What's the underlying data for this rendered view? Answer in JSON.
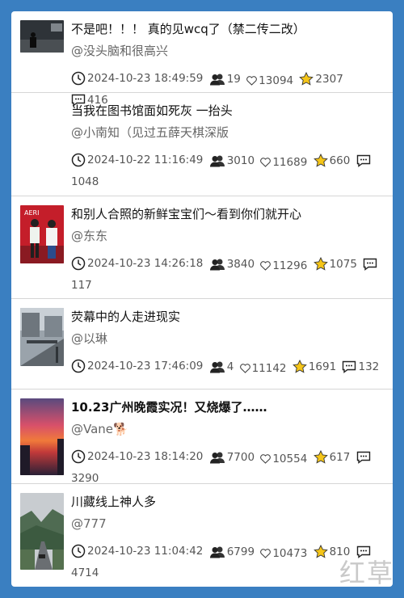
{
  "posts": [
    {
      "title": "不是吧！！！ 真的见wcq了（禁二传二改）",
      "author": "@没头脑和很高兴",
      "time": "2024-10-23 18:49:59",
      "users": "19",
      "likes": "13094",
      "stars": "2307",
      "comments": "416"
    },
    {
      "title": "当我在图书馆面如死灰 一抬头",
      "author": "@小南知（见过五薛天棋深版",
      "time": "2024-10-22 11:16:49",
      "users": "3010",
      "likes": "11689",
      "stars": "660",
      "comments": "1048"
    },
    {
      "title": "和别人合照的新鲜宝宝们～看到你们就开心",
      "author": "@东东",
      "time": "2024-10-23 14:26:18",
      "users": "3840",
      "likes": "11296",
      "stars": "1075",
      "comments": "117"
    },
    {
      "title": "荧幕中的人走进现实",
      "author": "@以琳",
      "time": "2024-10-23 17:46:09",
      "users": "4",
      "likes": "11142",
      "stars": "1691",
      "comments": "132"
    },
    {
      "title": "10.23广州晚霞实况！又烧爆了……",
      "author": "@Vane🐕",
      "time": "2024-10-23 18:14:20",
      "users": "7700",
      "likes": "10554",
      "stars": "617",
      "comments": "3290"
    },
    {
      "title": "川藏线上神人多",
      "author": "@777",
      "time": "2024-10-23 11:04:42",
      "users": "6799",
      "likes": "10473",
      "stars": "810",
      "comments": "4714"
    }
  ],
  "watermark": "红草",
  "colors": {
    "background": "#3a7fc1",
    "star": "#f5c518"
  }
}
